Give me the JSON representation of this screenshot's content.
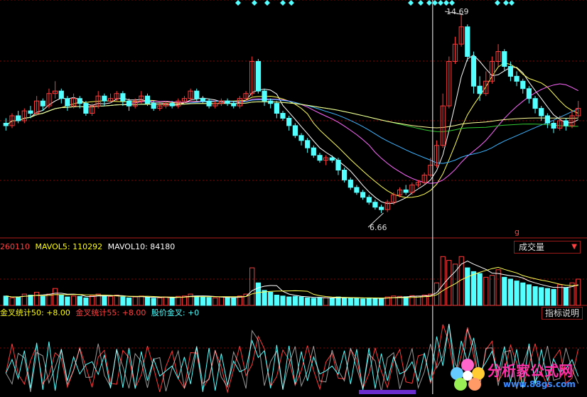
{
  "volume_panel": {
    "vol_value": "260110",
    "mavol5_label": "MAVOL5:",
    "mavol5_value": "110292",
    "mavol10_label": "MAVOL10:",
    "mavol10_value": "84180",
    "indicator_button": "成交量",
    "dropdown_glyph": "▼"
  },
  "indicator_panel": {
    "gc50_label": "金叉统计50:",
    "gc50_value": "+8.00",
    "gc55_label": "金叉统计55:",
    "gc55_value": "+8.00",
    "price_gc_label": "股价金叉:",
    "price_gc_value": "+0",
    "help_button": "指标说明"
  },
  "price_panel": {
    "high_label": "14.69",
    "low_label": "6.66",
    "marker_label": "g"
  },
  "watermark": {
    "text_cn": "分析家公式网",
    "text_url": "www.88gs.com"
  },
  "colors": {
    "background": "#000000",
    "grid": "#8b0000",
    "up": "#ff3b3b",
    "down": "#54ffff",
    "ma5": "#ffffff",
    "ma10": "#ffff55",
    "ma20": "#ff66ff",
    "ma30": "#3cb4ff",
    "ma60": "#33cc33",
    "ma120": "#ffff99",
    "label_yellow": "#ffff00",
    "label_red": "#ff4040"
  },
  "chart_data": {
    "type": "candlestick",
    "price_scale": [
      6.0,
      15.0
    ],
    "high": 14.69,
    "low": 6.66,
    "candles": [
      [
        10.3,
        10.2,
        10.5,
        10.0
      ],
      [
        10.2,
        10.6,
        10.7,
        10.1
      ],
      [
        10.6,
        10.4,
        10.8,
        10.3
      ],
      [
        10.4,
        10.8,
        10.9,
        10.3
      ],
      [
        10.8,
        10.7,
        11.0,
        10.5
      ],
      [
        10.7,
        11.2,
        11.4,
        10.6
      ],
      [
        11.2,
        11.0,
        11.3,
        10.8
      ],
      [
        11.0,
        11.5,
        11.7,
        10.9
      ],
      [
        11.5,
        11.6,
        12.0,
        11.3
      ],
      [
        11.6,
        11.3,
        11.7,
        11.1
      ],
      [
        11.3,
        11.0,
        11.4,
        10.8
      ],
      [
        11.0,
        11.3,
        11.5,
        10.9
      ],
      [
        11.3,
        11.1,
        11.4,
        10.9
      ],
      [
        11.1,
        10.7,
        11.2,
        10.6
      ],
      [
        10.7,
        11.0,
        11.1,
        10.6
      ],
      [
        11.0,
        11.4,
        11.6,
        10.9
      ],
      [
        11.4,
        11.2,
        11.5,
        11.0
      ],
      [
        11.2,
        11.3,
        11.5,
        11.1
      ],
      [
        11.3,
        11.5,
        11.6,
        11.2
      ],
      [
        11.5,
        11.2,
        11.6,
        11.0
      ],
      [
        11.2,
        11.0,
        11.3,
        10.8
      ],
      [
        11.0,
        11.2,
        11.3,
        10.9
      ],
      [
        11.2,
        11.4,
        11.6,
        11.1
      ],
      [
        11.4,
        11.1,
        11.5,
        11.0
      ],
      [
        11.1,
        10.9,
        11.2,
        10.8
      ],
      [
        10.9,
        11.0,
        11.1,
        10.8
      ],
      [
        11.0,
        11.1,
        11.2,
        10.9
      ],
      [
        11.1,
        11.0,
        11.2,
        10.9
      ],
      [
        11.0,
        11.2,
        11.3,
        10.9
      ],
      [
        11.2,
        11.3,
        11.4,
        11.1
      ],
      [
        11.3,
        11.6,
        11.7,
        11.2
      ],
      [
        11.6,
        11.3,
        11.7,
        11.2
      ],
      [
        11.3,
        11.2,
        11.4,
        11.1
      ],
      [
        11.2,
        11.0,
        11.3,
        10.9
      ],
      [
        11.0,
        11.1,
        11.2,
        10.9
      ],
      [
        11.1,
        11.2,
        11.3,
        11.0
      ],
      [
        11.2,
        11.1,
        11.3,
        11.0
      ],
      [
        11.1,
        11.0,
        11.2,
        10.9
      ],
      [
        11.0,
        11.3,
        11.4,
        10.9
      ],
      [
        11.3,
        11.5,
        11.6,
        11.2
      ],
      [
        11.5,
        12.8,
        13.0,
        11.4
      ],
      [
        12.8,
        11.6,
        12.9,
        11.5
      ],
      [
        11.6,
        11.2,
        11.7,
        11.0
      ],
      [
        11.2,
        11.1,
        11.3,
        10.9
      ],
      [
        11.1,
        10.7,
        11.2,
        10.5
      ],
      [
        10.7,
        10.5,
        10.8,
        10.4
      ],
      [
        10.5,
        10.2,
        10.6,
        10.0
      ],
      [
        10.2,
        9.8,
        10.3,
        9.7
      ],
      [
        9.8,
        9.6,
        9.9,
        9.4
      ],
      [
        9.6,
        9.3,
        9.7,
        9.1
      ],
      [
        9.3,
        9.0,
        9.4,
        8.9
      ],
      [
        9.0,
        8.8,
        9.1,
        8.7
      ],
      [
        8.8,
        8.9,
        9.0,
        8.6
      ],
      [
        8.9,
        8.8,
        9.0,
        8.7
      ],
      [
        8.8,
        8.4,
        8.9,
        8.2
      ],
      [
        8.4,
        8.0,
        8.5,
        7.9
      ],
      [
        8.0,
        7.7,
        8.1,
        7.6
      ],
      [
        7.7,
        7.5,
        7.8,
        7.4
      ],
      [
        7.5,
        7.3,
        7.6,
        7.2
      ],
      [
        7.3,
        7.1,
        7.4,
        7.0
      ],
      [
        7.1,
        6.9,
        7.2,
        6.8
      ],
      [
        6.9,
        6.8,
        7.0,
        6.66
      ],
      [
        6.8,
        7.1,
        7.2,
        6.7
      ],
      [
        7.1,
        7.4,
        7.5,
        7.0
      ],
      [
        7.4,
        7.6,
        7.7,
        7.3
      ],
      [
        7.6,
        7.5,
        7.8,
        7.4
      ],
      [
        7.5,
        7.8,
        7.9,
        7.4
      ],
      [
        7.8,
        7.9,
        8.0,
        7.7
      ],
      [
        7.9,
        8.2,
        8.3,
        7.8
      ],
      [
        8.2,
        8.6,
        8.9,
        8.1
      ],
      [
        8.6,
        9.4,
        9.6,
        8.5
      ],
      [
        9.4,
        11.0,
        11.5,
        9.3
      ],
      [
        11.0,
        12.8,
        13.0,
        10.9
      ],
      [
        12.8,
        13.5,
        13.8,
        12.7
      ],
      [
        13.5,
        14.2,
        14.69,
        13.4
      ],
      [
        14.2,
        13.0,
        14.3,
        12.8
      ],
      [
        13.0,
        11.8,
        13.2,
        11.5
      ],
      [
        11.8,
        11.5,
        12.2,
        11.2
      ],
      [
        11.5,
        12.0,
        12.4,
        11.4
      ],
      [
        12.0,
        12.8,
        13.0,
        11.9
      ],
      [
        12.8,
        13.2,
        13.5,
        12.6
      ],
      [
        13.2,
        12.6,
        13.3,
        12.4
      ],
      [
        12.6,
        12.2,
        12.8,
        12.0
      ],
      [
        12.2,
        12.0,
        12.4,
        11.8
      ],
      [
        12.0,
        11.7,
        12.1,
        11.5
      ],
      [
        11.7,
        11.3,
        11.8,
        11.1
      ],
      [
        11.3,
        10.9,
        11.4,
        10.7
      ],
      [
        10.9,
        10.6,
        11.0,
        10.4
      ],
      [
        10.6,
        10.3,
        10.7,
        10.1
      ],
      [
        10.3,
        10.1,
        10.4,
        9.9
      ],
      [
        10.1,
        10.4,
        10.6,
        10.0
      ],
      [
        10.4,
        10.2,
        10.5,
        10.0
      ],
      [
        10.2,
        10.6,
        10.8,
        10.1
      ],
      [
        10.6,
        10.9,
        11.2,
        10.5
      ]
    ],
    "volume": [
      50,
      40,
      45,
      60,
      55,
      70,
      48,
      60,
      90,
      55,
      45,
      50,
      48,
      40,
      52,
      60,
      50,
      48,
      55,
      45,
      40,
      45,
      50,
      42,
      38,
      40,
      45,
      42,
      48,
      50,
      60,
      50,
      45,
      42,
      40,
      45,
      42,
      40,
      50,
      60,
      200,
      120,
      80,
      70,
      55,
      50,
      45,
      48,
      45,
      40,
      38,
      42,
      40,
      38,
      45,
      42,
      40,
      38,
      35,
      40,
      38,
      36,
      45,
      50,
      48,
      46,
      52,
      50,
      55,
      60,
      120,
      260,
      240,
      220,
      260,
      200,
      180,
      170,
      150,
      160,
      190,
      150,
      140,
      130,
      120,
      110,
      100,
      95,
      90,
      85,
      110,
      95,
      120,
      140
    ]
  }
}
